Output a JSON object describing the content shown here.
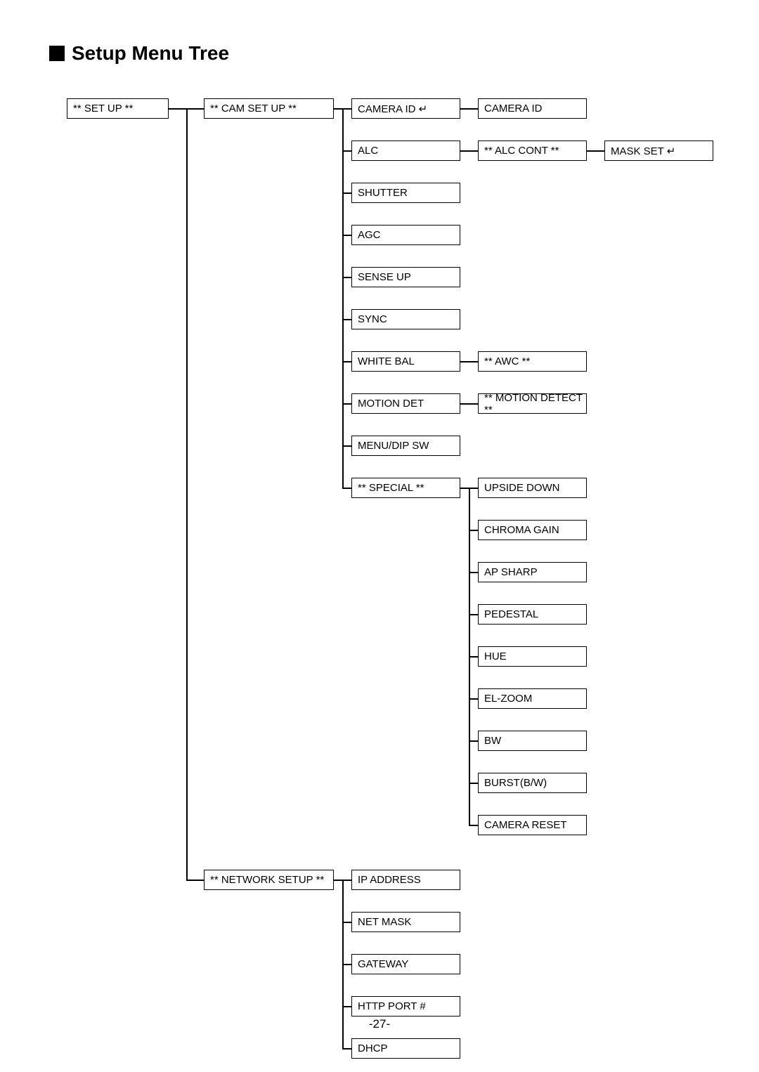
{
  "title": "Setup Menu Tree",
  "page_number": "-27-",
  "enter_symbol": "↵",
  "boxes": {
    "setup": "** SET UP **",
    "cam_setup": "** CAM  SET UP **",
    "network_setup": "** NETWORK SETUP **",
    "camera_id_sub": "CAMERA ID ↵",
    "camera_id": "CAMERA ID",
    "alc": "ALC",
    "alc_cont": "** ALC CONT **",
    "mask_set": "MASK SET ↵",
    "shutter": "SHUTTER",
    "agc": "AGC",
    "sense_up": "SENSE UP",
    "sync": "SYNC",
    "white_bal": "WHITE BAL",
    "awc": "** AWC **",
    "motion_det": "MOTION DET",
    "motion_detect": "** MOTION DETECT **",
    "menu_dip": "MENU/DIP SW",
    "special": "** SPECIAL **",
    "upside_down": "UPSIDE DOWN",
    "chroma_gain": "CHROMA GAIN",
    "ap_sharp": "AP SHARP",
    "pedestal": "PEDESTAL",
    "hue": "HUE",
    "el_zoom": "EL-ZOOM",
    "bw": "BW",
    "burst_bw": "BURST(B/W)",
    "camera_reset": "CAMERA RESET",
    "ip_address": "IP ADDRESS",
    "net_mask": "NET MASK",
    "gateway": "GATEWAY",
    "http_port": "HTTP PORT #",
    "dhcp": "DHCP"
  }
}
